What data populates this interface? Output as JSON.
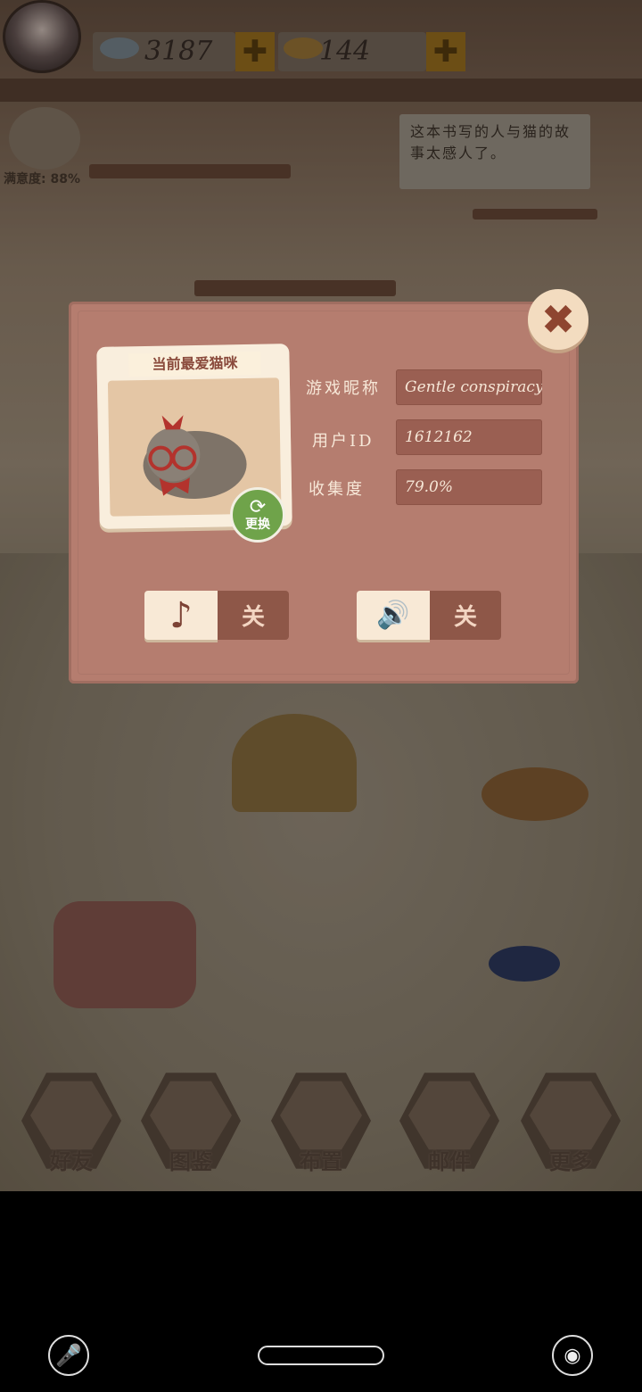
{
  "hud": {
    "currency_fish": "3187",
    "currency_gold_fish": "144",
    "plus": "✚",
    "satisfaction": "满意度: 88%",
    "note_text": "这本书写的人与猫的故事太感人了。"
  },
  "dialog": {
    "favorite_cat_title": "当前最爱猫咪",
    "swap_label": "更换",
    "swap_icon": "⟳",
    "close_icon": "✖",
    "fields": [
      {
        "label": "游戏昵称",
        "value": "Gentle conspiracy"
      },
      {
        "label": "用户ID",
        "value": "1612162"
      },
      {
        "label": "收集度",
        "value": "79.0%"
      }
    ],
    "music_toggle": {
      "icon": "♪",
      "state": "关"
    },
    "sound_toggle": {
      "icon": "🔊",
      "state": "关"
    }
  },
  "dock": [
    {
      "label": "好友",
      "icon": "friends-icon"
    },
    {
      "label": "图鉴",
      "icon": "book-icon"
    },
    {
      "label": "布置",
      "icon": "vase-icon"
    },
    {
      "label": "邮件",
      "icon": "mail-icon"
    },
    {
      "label": "更多",
      "icon": "question-icon"
    }
  ],
  "system_nav": {
    "mic_icon": "🎤",
    "eye_icon": "◉"
  }
}
